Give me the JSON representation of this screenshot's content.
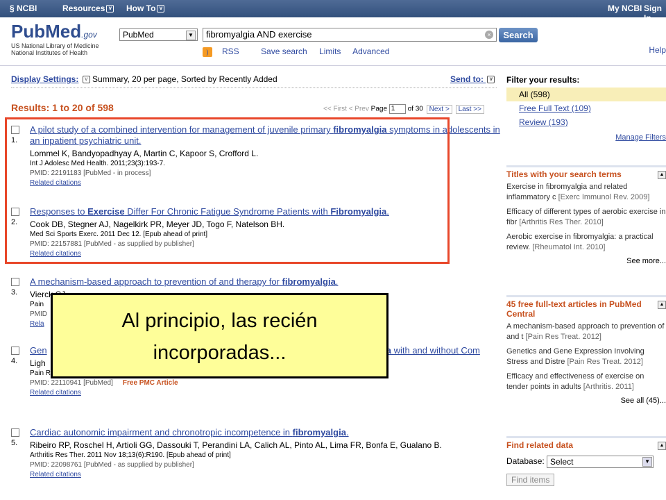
{
  "topbar": {
    "ncbi": "NCBI",
    "resources": "Resources",
    "howto": "How To",
    "myncbi": "My NCBI",
    "signin": "Sign In"
  },
  "logo": {
    "pub": "PubMed",
    "gov": ".gov",
    "line1": "US National Library of Medicine",
    "line2": "National Institutes of Health"
  },
  "search": {
    "database": "PubMed",
    "query": "fibromyalgia AND exercise",
    "button": "Search"
  },
  "sublinks": {
    "rss": "RSS",
    "save": "Save search",
    "limits": "Limits",
    "advanced": "Advanced",
    "help": "Help"
  },
  "display": {
    "label": "Display Settings:",
    "value": "Summary, 20 per page, Sorted by Recently Added",
    "sendto": "Send to:"
  },
  "results": {
    "label": "Results: 1 to 20 of 598"
  },
  "pager": {
    "first": "<< First",
    "prev": "< Prev",
    "page_label": "Page",
    "page": "1",
    "of": "of 30",
    "next": "Next >",
    "last": "Last >>"
  },
  "entries": [
    {
      "num": "1.",
      "title_parts": [
        "A pilot study of a combined intervention for management of juvenile primary ",
        "fibromyalgia",
        " symptoms in adolescents in an inpatient psychiatric unit."
      ],
      "authors": "Lommel K, Bandyopadhyay A, Martin C, Kapoor S, Crofford L.",
      "journal": "Int J Adolesc Med Health. 2011;23(3):193-7.",
      "pmid": "PMID: 22191183 [PubMed - in process]",
      "pmc": "",
      "related": "Related citations"
    },
    {
      "num": "2.",
      "title_parts": [
        "Responses to ",
        "Exercise",
        " Differ For Chronic Fatigue Syndrome Patients with ",
        "Fibromyalgia",
        "."
      ],
      "authors": "Cook DB, Stegner AJ, Nagelkirk PR, Meyer JD, Togo F, Natelson BH.",
      "journal": "Med Sci Sports Exerc. 2011 Dec 12. [Epub ahead of print]",
      "pmid": "PMID: 22157881 [PubMed - as supplied by publisher]",
      "pmc": "",
      "related": "Related citations"
    },
    {
      "num": "3.",
      "title_parts": [
        "A mechanism-based approach to prevention of and therapy for ",
        "fibromyalgia",
        "."
      ],
      "authors": "Vierck CJ",
      "journal": "Pain",
      "pmid": "PMID",
      "pmc": "",
      "related": "Rela"
    },
    {
      "num": "4.",
      "title_parts": [
        "Gen",
        "",
        "",
        "lgia",
        " with and without Com"
      ],
      "authors": "Ligh",
      "journal": "Pain Res Treat. 2012;2012:427869. Epub 2011 Sep 29.",
      "pmid": "PMID: 22110941 [PubMed]",
      "pmc": "Free PMC Article",
      "related": "Related citations"
    },
    {
      "num": "5.",
      "title_parts": [
        "Cardiac autonomic impairment and chronotropic incompetence in ",
        "fibromyalgia",
        "."
      ],
      "authors": "Ribeiro RP, Roschel H, Artioli GG, Dassouki T, Perandini LA, Calich AL, Pinto AL, Lima FR, Bonfa E, Gualano B.",
      "journal": "Arthritis Res Ther. 2011 Nov 18;13(6):R190. [Epub ahead of print]",
      "pmid": "PMID: 22098761 [PubMed - as supplied by publisher]",
      "pmc": "",
      "related": "Related citations"
    }
  ],
  "callout": {
    "line1": "Al principio, las recién",
    "line2": "incorporadas..."
  },
  "filters": {
    "header": "Filter your results:",
    "all": "All (598)",
    "free": "Free Full Text (109)",
    "review": "Review (193)",
    "manage": "Manage Filters"
  },
  "titles_box": {
    "header": "Titles with your search terms",
    "items": [
      {
        "text": "Exercise in fibromyalgia and related inflammatory c",
        "src": "[Exerc Immunol Rev. 2009]"
      },
      {
        "text": "Efficacy of different types of aerobic exercise in fibr",
        "src": "[Arthritis Res Ther. 2010]"
      },
      {
        "text": "Aerobic exercise in fibromyalgia: a practical review.",
        "src": "[Rheumatol Int. 2010]"
      }
    ],
    "more": "See more..."
  },
  "pmc_box": {
    "header": "45 free full-text articles in PubMed Central",
    "items": [
      {
        "text": "A mechanism-based approach to prevention of and t",
        "src": "[Pain Res Treat. 2012]"
      },
      {
        "text": "Genetics and Gene Expression Involving Stress and Distre",
        "src": "[Pain Res Treat. 2012]"
      },
      {
        "text": "Efficacy and effectiveness of exercise on tender points in adults",
        "src": "[Arthritis. 2011]"
      }
    ],
    "all": "See all (45)..."
  },
  "related_data": {
    "header": "Find related data",
    "db_label": "Database:",
    "select": "Select",
    "button": "Find items"
  }
}
